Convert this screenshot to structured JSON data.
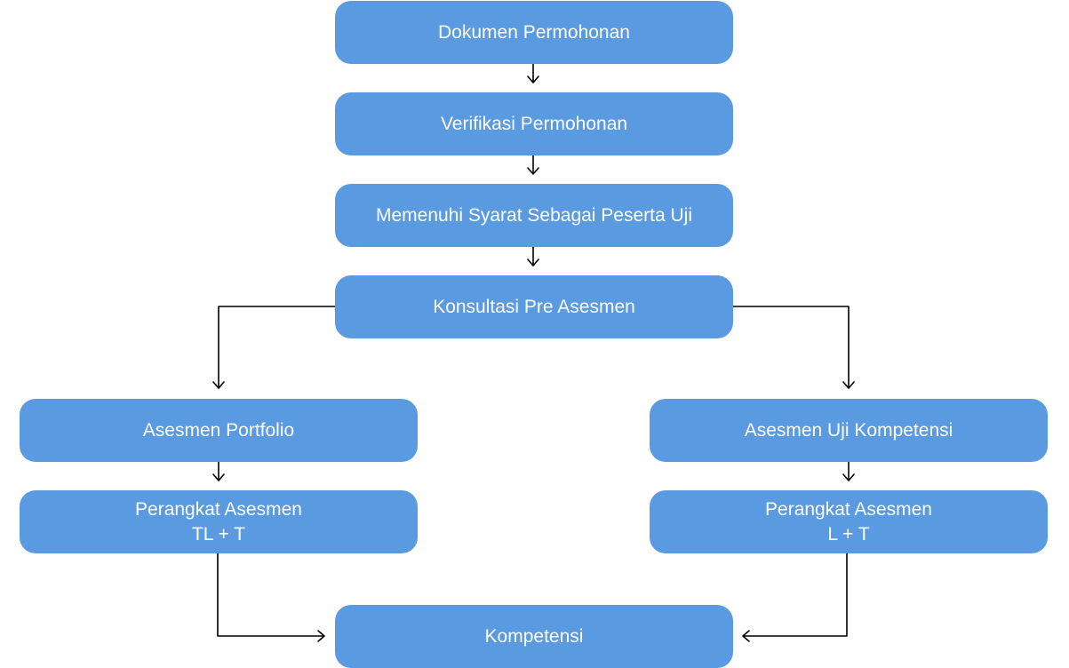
{
  "diagram": {
    "nodes": {
      "dokumen": "Dokumen Permohonan",
      "verifikasi": "Verifikasi Permohonan",
      "syarat": "Memenuhi Syarat Sebagai Peserta Uji",
      "konsultasi": "Konsultasi Pre Asesmen",
      "portfolio": "Asesmen Portfolio",
      "uji_kompetensi": "Asesmen Uji Kompetensi",
      "perangkat_left": {
        "line1": "Perangkat Asesmen",
        "line2": "TL + T"
      },
      "perangkat_right": {
        "line1": "Perangkat Asesmen",
        "line2": "L + T"
      },
      "kompetensi": "Kompetensi"
    },
    "colors": {
      "node_fill": "#5a9ae0",
      "node_text": "#ffffff",
      "connector": "#000000"
    }
  }
}
